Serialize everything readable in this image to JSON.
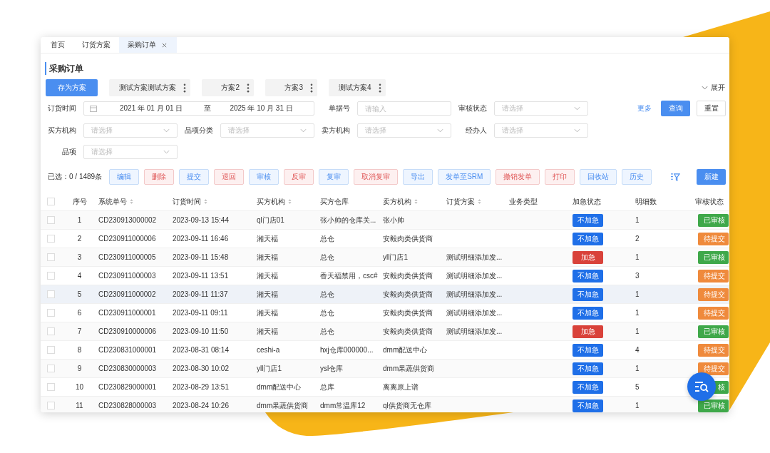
{
  "tabs": [
    {
      "label": "首页",
      "selected": false,
      "closable": false
    },
    {
      "label": "订货方案",
      "selected": false,
      "closable": false
    },
    {
      "label": "采购订单",
      "selected": true,
      "closable": true
    }
  ],
  "page_title": "采购订单",
  "save_plan_button": "存为方案",
  "plans": [
    {
      "label": "测试方案测试方案"
    },
    {
      "label": "方案2"
    },
    {
      "label": "方案3"
    },
    {
      "label": "测试方案4"
    }
  ],
  "expand_toggle": "展开",
  "filters": {
    "date_label": "订货时间",
    "date_from": "2021 年 01 月 01 日",
    "date_sep": "至",
    "date_to": "2025 年 10 月 31 日",
    "doc_no_label": "单据号",
    "doc_no_placeholder": "请输入",
    "audit_label": "审核状态",
    "audit_placeholder": "请选择",
    "buyer_label": "买方机构",
    "buyer_placeholder": "请选择",
    "category_label": "品项分类",
    "category_placeholder": "请选择",
    "seller_label": "卖方机构",
    "seller_placeholder": "请选择",
    "handler_label": "经办人",
    "handler_placeholder": "请选择",
    "item_label": "品项",
    "item_placeholder": "请选择",
    "more_link": "更多",
    "query_button": "查询",
    "reset_button": "重置"
  },
  "selection_summary": "已选：0 / 1489条",
  "actions": [
    {
      "label": "编辑",
      "kind": "primary"
    },
    {
      "label": "删除",
      "kind": "danger"
    },
    {
      "label": "提交",
      "kind": "primary"
    },
    {
      "label": "退回",
      "kind": "danger"
    },
    {
      "label": "审核",
      "kind": "primary"
    },
    {
      "label": "反审",
      "kind": "danger"
    },
    {
      "label": "复审",
      "kind": "primary"
    },
    {
      "label": "取消复审",
      "kind": "danger"
    },
    {
      "label": "导出",
      "kind": "primary"
    },
    {
      "label": "发单至SRM",
      "kind": "primary"
    },
    {
      "label": "撤销发单",
      "kind": "danger"
    },
    {
      "label": "打印",
      "kind": "danger"
    },
    {
      "label": "回收站",
      "kind": "primary"
    },
    {
      "label": "历史",
      "kind": "primary"
    }
  ],
  "new_button": "新建",
  "table": {
    "all_checked": false,
    "columns": [
      {
        "label": "序号",
        "sortable": false
      },
      {
        "label": "系统单号",
        "sortable": true
      },
      {
        "label": "订货时间",
        "sortable": true
      },
      {
        "label": "买方机构",
        "sortable": true
      },
      {
        "label": "买方仓库",
        "sortable": false
      },
      {
        "label": "卖方机构",
        "sortable": true
      },
      {
        "label": "订货方案",
        "sortable": true
      },
      {
        "label": "业务类型",
        "sortable": false
      },
      {
        "label": "加急状态",
        "sortable": false
      },
      {
        "label": "明细数",
        "sortable": false
      },
      {
        "label": "审核状态",
        "sortable": false
      }
    ],
    "rows": [
      {
        "no": "1",
        "code": "CD230913000002",
        "time": "2023-09-13 15:44",
        "buyer": "ql门店01",
        "warehouse": "张小帅的仓库关...",
        "seller": "张小帅",
        "urgency": {
          "label": "不加急",
          "kind": "normal"
        },
        "count": "1",
        "status": {
          "label": "已审核",
          "kind": "approved"
        },
        "checked": false,
        "selected": false
      },
      {
        "no": "2",
        "code": "CD230911000006",
        "time": "2023-09-11 16:46",
        "buyer": "湘天福",
        "warehouse": "总仓",
        "seller": "安毅肉类供货商",
        "urgency": {
          "label": "不加急",
          "kind": "normal"
        },
        "count": "2",
        "status": {
          "label": "待提交",
          "kind": "pending"
        },
        "checked": false,
        "selected": false
      },
      {
        "no": "3",
        "code": "CD230911000005",
        "time": "2023-09-11 15:48",
        "buyer": "湘天福",
        "warehouse": "总仓",
        "seller": "yll门店1",
        "plan": "测试明细添加发...",
        "urgency": {
          "label": "加急",
          "kind": "urgent"
        },
        "count": "1",
        "status": {
          "label": "已审核",
          "kind": "approved"
        },
        "checked": false,
        "selected": false
      },
      {
        "no": "4",
        "code": "CD230911000003",
        "time": "2023-09-11 13:51",
        "buyer": "湘天福",
        "warehouse": "香天福禁用，csc#",
        "seller": "安毅肉类供货商",
        "plan": "测试明细添加发...",
        "urgency": {
          "label": "不加急",
          "kind": "normal"
        },
        "count": "3",
        "status": {
          "label": "待提交",
          "kind": "pending"
        },
        "checked": false,
        "selected": false
      },
      {
        "no": "5",
        "code": "CD230911000002",
        "time": "2023-09-11 11:37",
        "buyer": "湘天福",
        "warehouse": "总仓",
        "seller": "安毅肉类供货商",
        "plan": "测试明细添加发...",
        "urgency": {
          "label": "不加急",
          "kind": "normal"
        },
        "count": "1",
        "status": {
          "label": "待提交",
          "kind": "pending"
        },
        "checked": false,
        "selected": true
      },
      {
        "no": "6",
        "code": "CD230911000001",
        "time": "2023-09-11 09:11",
        "buyer": "湘天福",
        "warehouse": "总仓",
        "seller": "安毅肉类供货商",
        "plan": "测试明细添加发...",
        "urgency": {
          "label": "不加急",
          "kind": "normal"
        },
        "count": "1",
        "status": {
          "label": "待提交",
          "kind": "pending"
        },
        "checked": false,
        "selected": false
      },
      {
        "no": "7",
        "code": "CD230910000006",
        "time": "2023-09-10 11:50",
        "buyer": "湘天福",
        "warehouse": "总仓",
        "seller": "安毅肉类供货商",
        "plan": "测试明细添加发...",
        "urgency": {
          "label": "加急",
          "kind": "urgent"
        },
        "count": "1",
        "status": {
          "label": "已审核",
          "kind": "approved"
        },
        "checked": false,
        "selected": false
      },
      {
        "no": "8",
        "code": "CD230831000001",
        "time": "2023-08-31 08:14",
        "buyer": "ceshi-a",
        "warehouse": "hxj仓库000000...",
        "seller": "dmm配送中心",
        "urgency": {
          "label": "不加急",
          "kind": "normal"
        },
        "count": "4",
        "status": {
          "label": "待提交",
          "kind": "pending"
        },
        "checked": false,
        "selected": false
      },
      {
        "no": "9",
        "code": "CD230830000003",
        "time": "2023-08-30 10:02",
        "buyer": "yll门店1",
        "warehouse": "ysl仓库",
        "seller": "dmm果蔬供货商",
        "urgency": {
          "label": "不加急",
          "kind": "normal"
        },
        "count": "1",
        "status": {
          "label": "待提交",
          "kind": "pending"
        },
        "checked": false,
        "selected": false
      },
      {
        "no": "10",
        "code": "CD230829000001",
        "time": "2023-08-29 13:51",
        "buyer": "dmm配送中心",
        "warehouse": "总库",
        "seller": "离离原上谱",
        "urgency": {
          "label": "不加急",
          "kind": "normal"
        },
        "count": "5",
        "status": {
          "label": "核",
          "kind": "approved"
        },
        "checked": false,
        "selected": false
      },
      {
        "no": "11",
        "code": "CD230828000003",
        "time": "2023-08-24 10:26",
        "buyer": "dmm果蔬供货商",
        "warehouse": "dmm常温库12",
        "seller": "ql供货商无仓库",
        "urgency": {
          "label": "不加急",
          "kind": "normal"
        },
        "count": "1",
        "status": {
          "label": "已审核",
          "kind": "approved"
        },
        "checked": false,
        "selected": false
      }
    ]
  }
}
